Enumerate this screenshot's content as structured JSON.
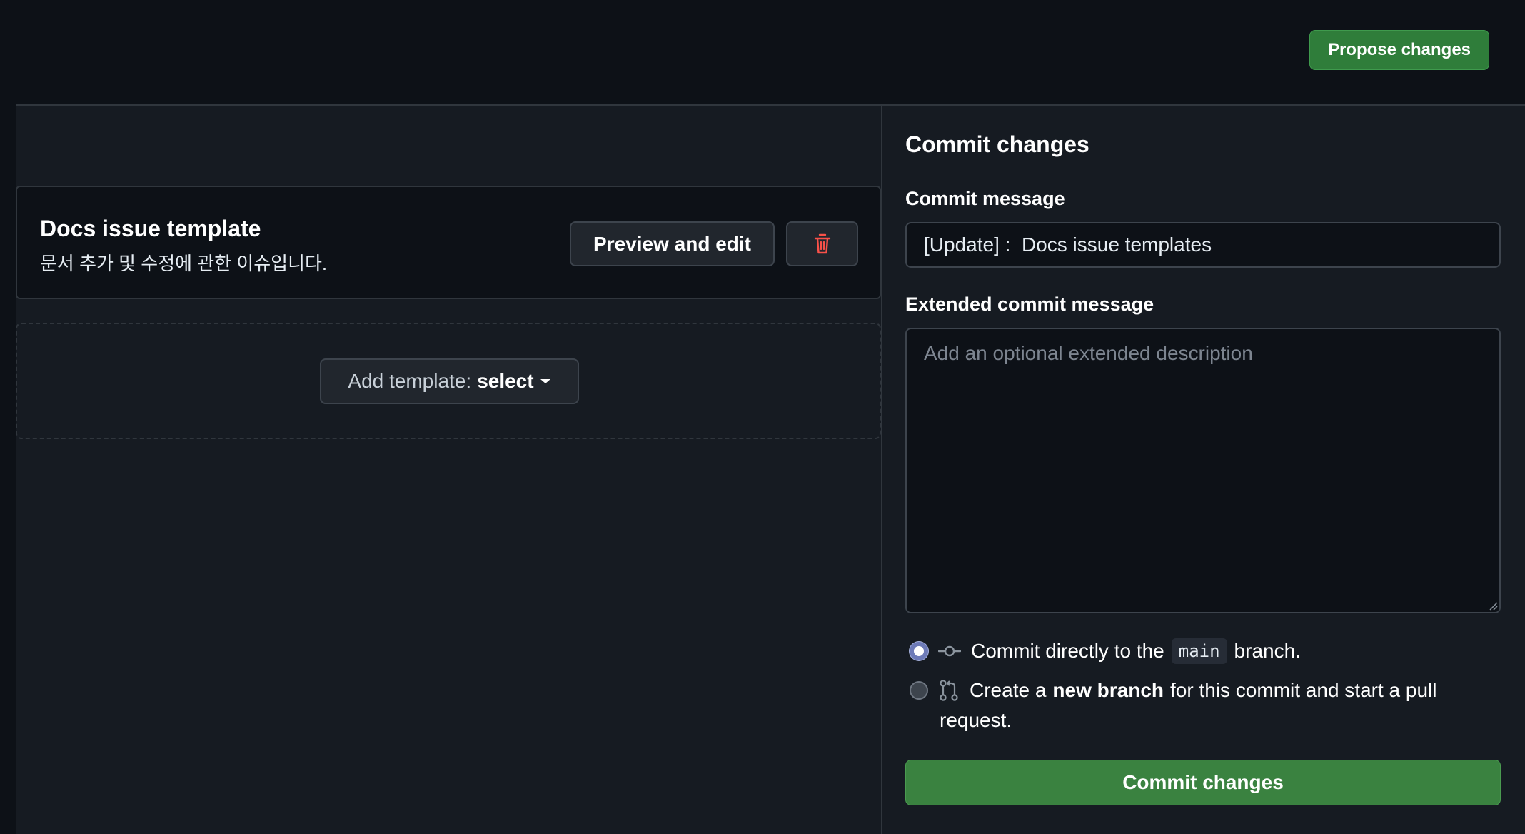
{
  "header": {
    "propose_label": "Propose changes"
  },
  "templates": {
    "items": [
      {
        "name": "Docs issue template",
        "description": "문서 추가 및 수정에 관한 이슈입니다.",
        "preview_label": "Preview and edit"
      }
    ],
    "add_label_prefix": "Add template:",
    "add_label_value": "select"
  },
  "commit": {
    "title": "Commit changes",
    "message_label": "Commit message",
    "message_value": "[Update] :  Docs issue templates",
    "extended_label": "Extended commit message",
    "extended_placeholder": "Add an optional extended description",
    "option_direct_prefix": "Commit directly to the",
    "option_direct_branch": "main",
    "option_direct_suffix": "branch.",
    "option_new_prefix": "Create a",
    "option_new_bold": "new branch",
    "option_new_suffix": "for this commit and start a pull",
    "option_new_suffix2": "request.",
    "submit_label": "Commit changes"
  },
  "colors": {
    "accent_green": "#2f7d3a",
    "danger_red": "#f85149",
    "background": "#0d1117",
    "panel": "#161b22"
  },
  "icons": {
    "delete": "trash-icon",
    "commit": "git-commit-icon",
    "pull_request": "git-pull-request-icon",
    "caret": "caret-down-icon"
  }
}
